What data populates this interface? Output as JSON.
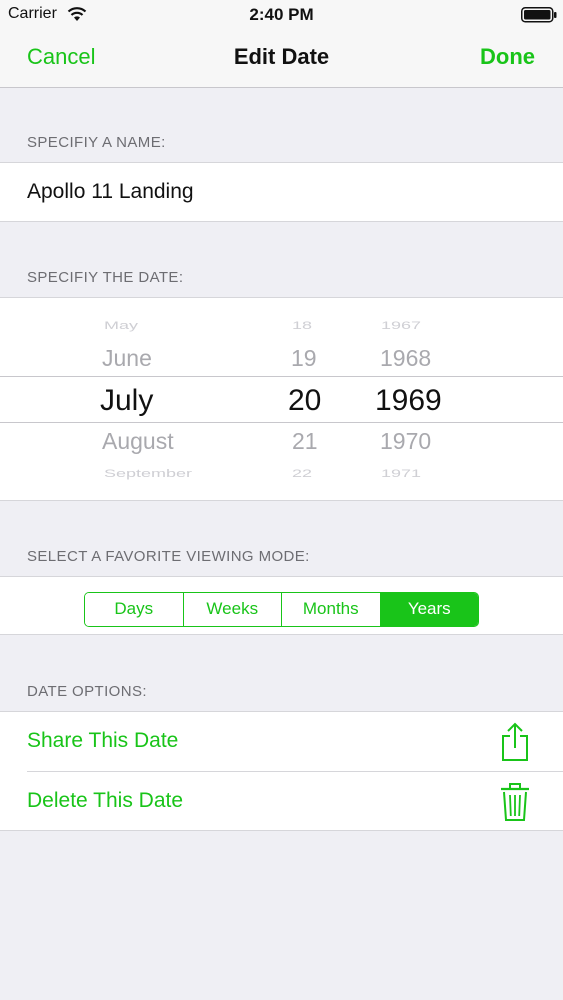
{
  "status_bar": {
    "carrier": "Carrier",
    "time": "2:40 PM"
  },
  "nav": {
    "cancel_label": "Cancel",
    "title": "Edit Date",
    "done_label": "Done"
  },
  "name_section": {
    "header": "SPECIFIY A NAME:",
    "value": "Apollo 11 Landing"
  },
  "date_section": {
    "header": "SPECIFIY THE DATE:",
    "months": [
      "May",
      "June",
      "July",
      "August",
      "September"
    ],
    "days": [
      "18",
      "19",
      "20",
      "21",
      "22"
    ],
    "years": [
      "1967",
      "1968",
      "1969",
      "1970",
      "1971"
    ],
    "selected": {
      "month": "July",
      "day": "20",
      "year": "1969"
    }
  },
  "viewing_mode": {
    "header": "SELECT A FAVORITE VIEWING MODE:",
    "segments": [
      "Days",
      "Weeks",
      "Months",
      "Years"
    ],
    "selected": "Years"
  },
  "options": {
    "header": "DATE OPTIONS:",
    "items": [
      {
        "label": "Share This Date",
        "icon": "share-icon"
      },
      {
        "label": "Delete This Date",
        "icon": "trash-icon"
      }
    ]
  },
  "colors": {
    "accent": "#19c419",
    "background": "#efeff4",
    "header_text": "#6d6d72"
  }
}
